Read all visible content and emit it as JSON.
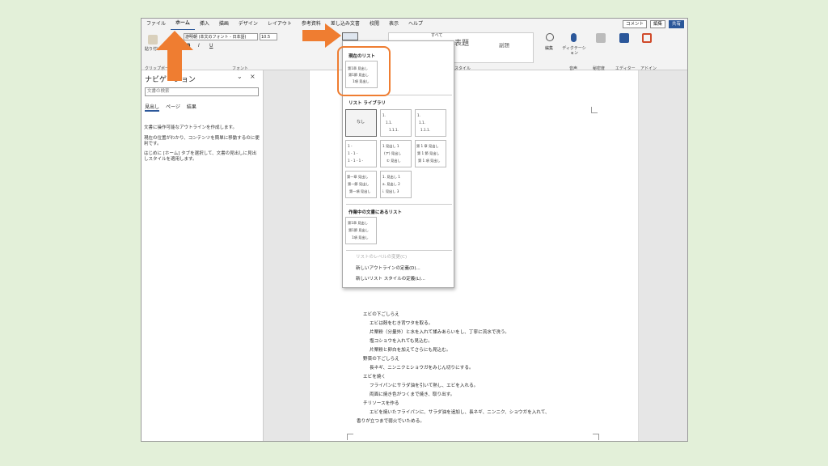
{
  "menu": {
    "tabs": [
      "ファイル",
      "ホーム",
      "挿入",
      "描画",
      "デザイン",
      "レイアウト",
      "参考資料",
      "差し込み文書",
      "校閲",
      "表示",
      "ヘルプ"
    ],
    "active": "ホーム"
  },
  "title_buttons": {
    "comment": "コメント",
    "edit": "編集",
    "share": "共有"
  },
  "ribbon": {
    "paste": "貼り付け",
    "clipboard": "クリップボード",
    "font_name": "游明朝 (本文のフォント - 日本語)",
    "font_size": "10.5",
    "font_group": "フォント",
    "style_all": "すべて",
    "style_heading": "表題",
    "style_subtitle": "副題",
    "style_group": "スタイル",
    "edit_label": "編集",
    "dictate": "ディクテーション",
    "dictate_group": "音声",
    "sensitivity": "秘密度",
    "editor": "エディター",
    "addin": "アドイン",
    "bold": "B",
    "italic": "I",
    "underline": "U"
  },
  "nav": {
    "title": "ナビゲーション",
    "search_placeholder": "文書の検索",
    "tabs": [
      "見出し",
      "ページ",
      "結果"
    ],
    "text1": "文書に操作可能なアウトラインを作成します。",
    "text2": "現在の位置がわかり、コンテンツを簡単に移動するのに便利です。",
    "text3": "はじめに [ホーム] タブを選択して、文書の見出しに見出しスタイルを適用します。"
  },
  "dropdown": {
    "current_list": "現在のリスト",
    "library": "リスト ライブラリ",
    "none": "なし",
    "in_doc": "作業中の文書にあるリスト",
    "change_level": "リストのレベルの変更(C)",
    "new_outline": "新しいアウトラインの定義(D)...",
    "new_style": "新しいリスト スタイルの定義(L)...",
    "chapter_lines": [
      "第1章 見出し",
      "第1節 見出し",
      "1項 見出し"
    ],
    "lib_cells": [
      [
        "1.",
        "1.1.",
        "1.1.1."
      ],
      [
        "1.",
        "1.1.",
        "1.1.1."
      ],
      [
        "1 -",
        "1 - 1 -",
        "1 - 1 - 1 -"
      ],
      [
        "1 見出し 1",
        "(ア) 見出し",
        "① 見出し"
      ],
      [
        "第 1 章 見出し",
        "第 1 節 見出し",
        "第 1 項 見出し"
      ],
      [
        "第一章 見出し",
        "第一節 見出し",
        "第一項 見出し"
      ],
      [
        "1. 見出し 1",
        "a. 見出し 2",
        "i. 見出し 3"
      ]
    ]
  },
  "doc": {
    "lines": [
      "エビの下ごしらえ",
      "エビは殻をむき背ワタを取る。",
      "片栗粉（分量外）と水を入れて揉みあらいをし、丁寧に流水で洗う。",
      "塩コショウを入れても見込む。",
      "片栗粉と卵白を加えてさらにも見込む。",
      "野菜の下ごしらえ",
      "長ネギ、ニンニクとショウガをみじん切りにする。",
      "エビを焼く",
      "フライパンにサラダ油を引いて熱し、エビを入れる。",
      "両面に焼き色がつくまで焼き、取り出す。",
      "チリソースを作る",
      "エビを焼いたフライパンに、サラダ油を追加し、長ネギ、ニンニク、ショウガを入れて、",
      "香りが立つまで弱火でいためる。"
    ]
  },
  "colors": {
    "accent": "#2b579a",
    "arrow": "#ef7d31",
    "bg": "#e3f0d9"
  }
}
